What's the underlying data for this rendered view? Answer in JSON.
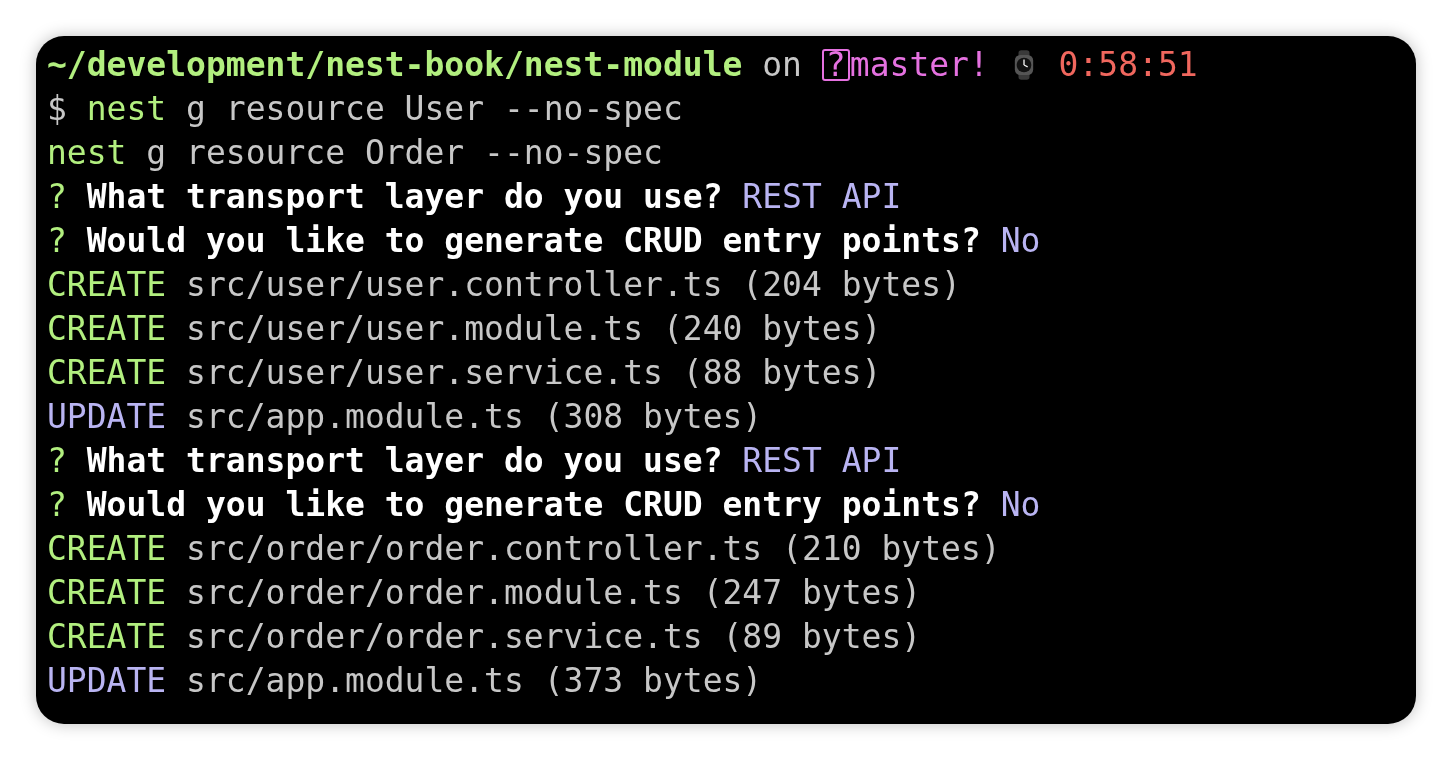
{
  "prompt": {
    "path": "~/development/nest-book/nest-module",
    "connector": "on",
    "git_status": "?",
    "branch": "master!",
    "time": "0:58:51"
  },
  "lines": [
    {
      "segments": [
        {
          "kind": "dollar",
          "text": "$"
        },
        {
          "kind": "command",
          "text": "nest"
        },
        {
          "kind": "args",
          "text": "g resource User --no-spec"
        }
      ]
    },
    {
      "segments": [
        {
          "kind": "command",
          "text": "nest"
        },
        {
          "kind": "args",
          "text": "g resource Order --no-spec"
        }
      ]
    },
    {
      "segments": [
        {
          "kind": "question-mark",
          "text": "?"
        },
        {
          "kind": "question",
          "text": "What transport layer do you use?"
        },
        {
          "kind": "answer",
          "text": "REST API"
        }
      ]
    },
    {
      "segments": [
        {
          "kind": "question-mark",
          "text": "?"
        },
        {
          "kind": "question",
          "text": "Would you like to generate CRUD entry points?"
        },
        {
          "kind": "answer",
          "text": "No"
        }
      ]
    },
    {
      "segments": [
        {
          "kind": "create",
          "text": "CREATE"
        },
        {
          "kind": "file",
          "text": "src/user/user.controller.ts (204 bytes)"
        }
      ]
    },
    {
      "segments": [
        {
          "kind": "create",
          "text": "CREATE"
        },
        {
          "kind": "file",
          "text": "src/user/user.module.ts (240 bytes)"
        }
      ]
    },
    {
      "segments": [
        {
          "kind": "create",
          "text": "CREATE"
        },
        {
          "kind": "file",
          "text": "src/user/user.service.ts (88 bytes)"
        }
      ]
    },
    {
      "segments": [
        {
          "kind": "update",
          "text": "UPDATE"
        },
        {
          "kind": "file",
          "text": "src/app.module.ts (308 bytes)"
        }
      ]
    },
    {
      "segments": [
        {
          "kind": "question-mark",
          "text": "?"
        },
        {
          "kind": "question",
          "text": "What transport layer do you use?"
        },
        {
          "kind": "answer",
          "text": "REST API"
        }
      ]
    },
    {
      "segments": [
        {
          "kind": "question-mark",
          "text": "?"
        },
        {
          "kind": "question",
          "text": "Would you like to generate CRUD entry points?"
        },
        {
          "kind": "answer",
          "text": "No"
        }
      ]
    },
    {
      "segments": [
        {
          "kind": "create",
          "text": "CREATE"
        },
        {
          "kind": "file",
          "text": "src/order/order.controller.ts (210 bytes)"
        }
      ]
    },
    {
      "segments": [
        {
          "kind": "create",
          "text": "CREATE"
        },
        {
          "kind": "file",
          "text": "src/order/order.module.ts (247 bytes)"
        }
      ]
    },
    {
      "segments": [
        {
          "kind": "create",
          "text": "CREATE"
        },
        {
          "kind": "file",
          "text": "src/order/order.service.ts (89 bytes)"
        }
      ]
    },
    {
      "segments": [
        {
          "kind": "update",
          "text": "UPDATE"
        },
        {
          "kind": "file",
          "text": "src/app.module.ts (373 bytes)"
        }
      ]
    }
  ]
}
